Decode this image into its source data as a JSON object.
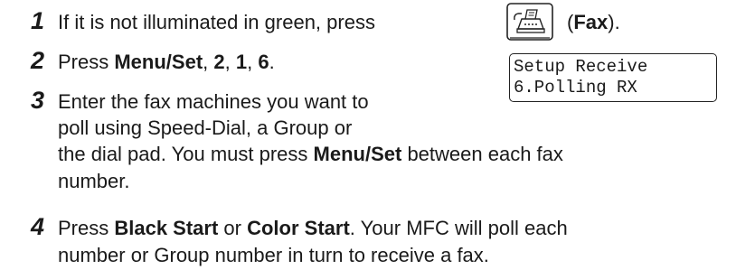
{
  "steps": [
    {
      "num": "1",
      "before": "If it is not illuminated in green, press",
      "open_paren": "(",
      "bold": "Fax",
      "close_paren": ")."
    },
    {
      "num": "2",
      "prefix": "Press ",
      "menu": "Menu/Set",
      "sep1": ", ",
      "d1": "2",
      "sep2": ", ",
      "d2": "1",
      "sep3": ", ",
      "d3": "6",
      "end": "."
    },
    {
      "num": "3",
      "line1": "Enter the fax machines you want to",
      "line2": "poll using Speed-Dial, a Group or",
      "line3_pre": "the dial pad. You must press ",
      "line3_bold": "Menu/Set",
      "line3_post": " between each fax",
      "line4": "number."
    },
    {
      "num": "4",
      "prefix": "Press ",
      "bold1": "Black Start",
      "mid": " or ",
      "bold2": "Color Start",
      "post": ". Your MFC will poll each",
      "line2": "number or Group number in turn to receive a fax."
    }
  ],
  "lcd": {
    "line1": "Setup Receive",
    "line2": "6.Polling RX"
  },
  "icons": {
    "fax_key": "fax-machine-icon"
  }
}
